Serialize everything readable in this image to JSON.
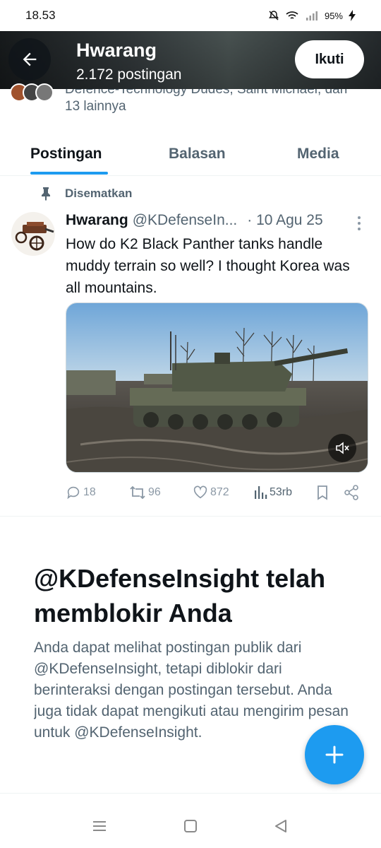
{
  "status_bar": {
    "time": "18.53",
    "battery": "95%"
  },
  "header": {
    "title": "Hwarang",
    "subtitle": "2.172 postingan",
    "follow_label": "Ikuti"
  },
  "followers": {
    "line1": "Defence-Technology Dudes, Saint Michael, dan",
    "line2": "13 lainnya"
  },
  "tabs": [
    {
      "label": "Postingan"
    },
    {
      "label": "Balasan"
    },
    {
      "label": "Media"
    }
  ],
  "pinned_post": {
    "pinned_label": "Disematkan",
    "author_name": "Hwarang",
    "author_handle": "@KDefenseIn...",
    "date": "· 10 Agu 25",
    "text": "How do K2 Black Panther tanks handle muddy terrain so well? I thought Korea was all mountains.",
    "stats": {
      "replies": "18",
      "reposts": "96",
      "likes": "872",
      "views": "53rb"
    }
  },
  "blocked": {
    "title": "@KDefenseInsight telah memblokir Anda",
    "description": "Anda dapat melihat postingan publik dari @KDefenseInsight, tetapi diblokir dari berinteraksi dengan postingan tersebut. Anda juga tidak dapat mengikuti atau mengirim pesan untuk @KDefenseInsight."
  },
  "colors": {
    "accent": "#1d9bf0",
    "text_primary": "#0f1419",
    "text_secondary": "#536471"
  }
}
